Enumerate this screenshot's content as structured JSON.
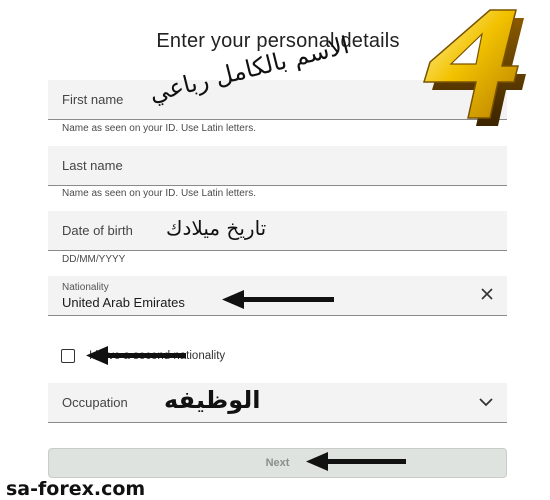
{
  "title": "Enter your personal details",
  "first_name": {
    "label": "First name",
    "helper": "Name as seen on your ID. Use Latin letters."
  },
  "last_name": {
    "label": "Last name",
    "helper": "Name as seen on your ID. Use Latin letters."
  },
  "dob": {
    "label": "Date of birth",
    "helper": "DD/MM/YYYY"
  },
  "nationality": {
    "label": "Nationality",
    "value": "United Arab Emirates"
  },
  "second_nationality": {
    "label": "I have a second nationality",
    "checked": false
  },
  "occupation": {
    "label": "Occupation"
  },
  "next_button": {
    "label": "Next"
  },
  "annotations": {
    "full_name": "الاسم بالكامل رباعي",
    "birth_date": "تاريخ ميلادك",
    "job": "الوظيفه"
  },
  "watermark": "sa-forex.com",
  "logo_digit": "4",
  "icons": [
    "close-icon",
    "chevron-down-icon",
    "arrow-left-icon"
  ]
}
